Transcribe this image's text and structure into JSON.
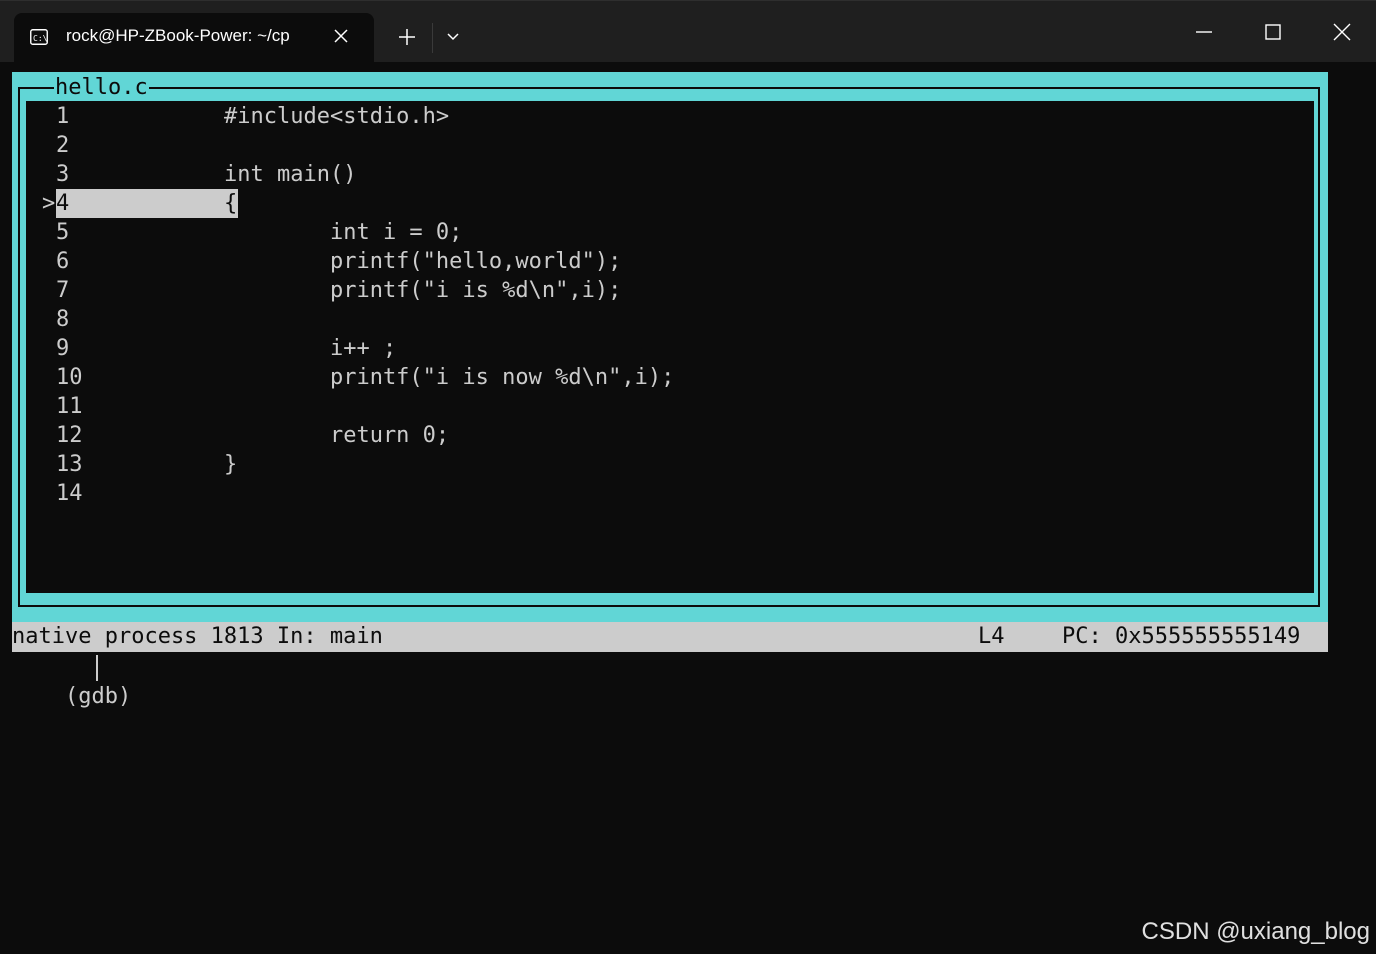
{
  "titlebar": {
    "tab_title": "rock@HP-ZBook-Power: ~/cp",
    "tab_icon": "terminal-icon",
    "close_icon": "close-icon",
    "new_tab_icon": "plus-icon",
    "dropdown_icon": "chevron-down-icon",
    "window_controls": [
      "minimize-icon",
      "maximize-icon",
      "close-icon"
    ]
  },
  "source": {
    "filename": "hello.c",
    "current_marker": ">",
    "lines": [
      {
        "num": "1",
        "code": "#include<stdio.h>"
      },
      {
        "num": "2",
        "code": ""
      },
      {
        "num": "3",
        "code": "int main()"
      },
      {
        "num": "4",
        "code": "{"
      },
      {
        "num": "5",
        "code": "        int i = 0;"
      },
      {
        "num": "6",
        "code": "        printf(\"hello,world\");"
      },
      {
        "num": "7",
        "code": "        printf(\"i is %d\\n\",i);"
      },
      {
        "num": "8",
        "code": ""
      },
      {
        "num": "9",
        "code": "        i++ ;"
      },
      {
        "num": "10",
        "code": "        printf(\"i is now %d\\n\",i);"
      },
      {
        "num": "11",
        "code": ""
      },
      {
        "num": "12",
        "code": "        return 0;"
      },
      {
        "num": "13",
        "code": "}"
      },
      {
        "num": "14",
        "code": ""
      }
    ]
  },
  "status": {
    "left": "native process 1813 In: main",
    "line": "L4",
    "pc": "PC: 0x555555555149"
  },
  "prompt": "(gdb) ",
  "watermark": "CSDN @uxiang_blog",
  "colors": {
    "background": "#0c0c0c",
    "tui_border": "#61d6d6",
    "text": "#cccccc",
    "highlight": "#cccccc"
  }
}
